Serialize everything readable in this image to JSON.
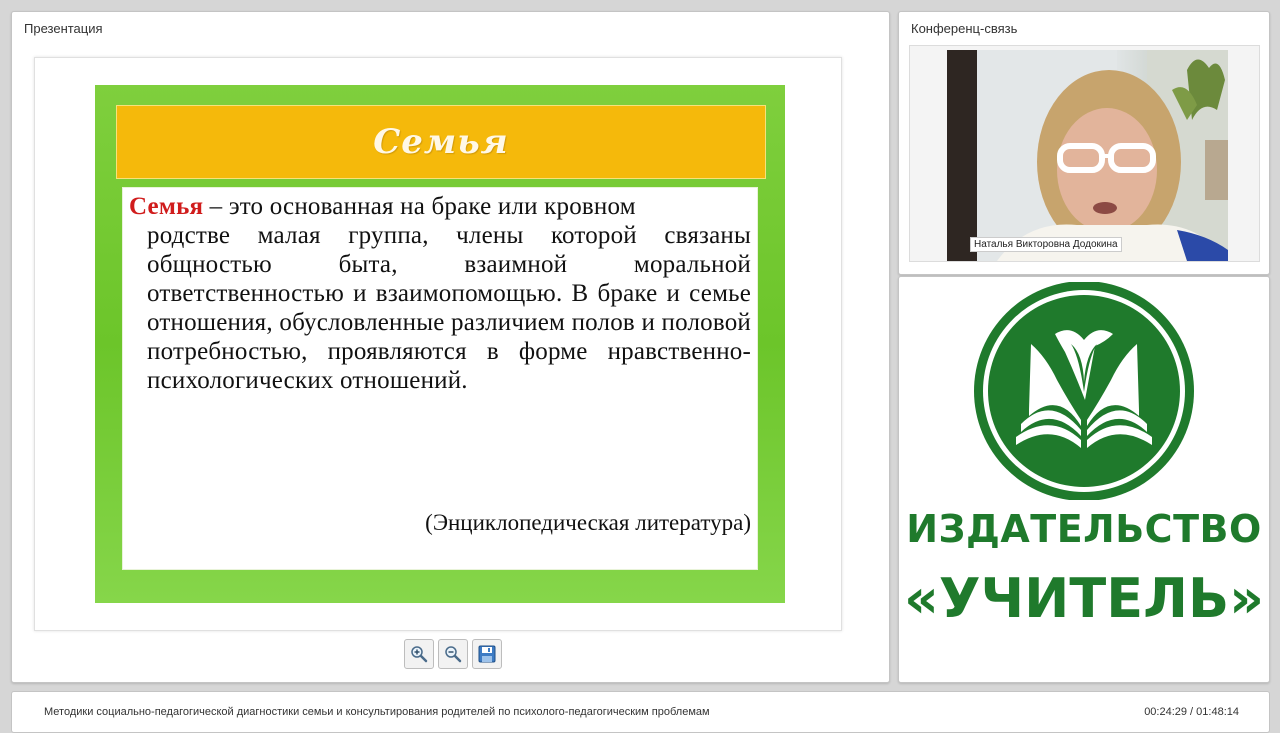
{
  "presentation": {
    "panel_title": "Презентация",
    "slide": {
      "title": "Семья",
      "term": "Семья",
      "line1_rest": " – это основанная на браке или кровном",
      "definition_rest": "родстве малая группа, члены которой связаны общностью быта, взаимной моральной ответственностью и взаимопомощью. В браке и семье отношения, обусловленные различием полов и половой потребностью, проявляются в форме нравственно-психологических отношений.",
      "source": "(Энциклопедическая литература)"
    },
    "toolbar": {
      "zoom_in_icon": "zoom-in-icon",
      "zoom_out_icon": "zoom-out-icon",
      "save_icon": "save-icon"
    }
  },
  "conference": {
    "panel_title": "Конференц-связь",
    "participant_name": "Наталья Викторовна Додокина"
  },
  "publisher": {
    "line1": "ИЗДАТЕЛЬСТВО",
    "line2": "«УЧИТЕЛЬ»",
    "brand_color": "#1f7a2c"
  },
  "footer": {
    "course_title": "Методики социально-педагогической диагностики семьи и консультирования родителей по психолого-педагогическим проблемам",
    "timecode": "00:24:29 / 01:48:14"
  },
  "colors": {
    "slide_green": "#6cc52a",
    "slide_header": "#f5b90b",
    "term_red": "#d01c1c"
  }
}
